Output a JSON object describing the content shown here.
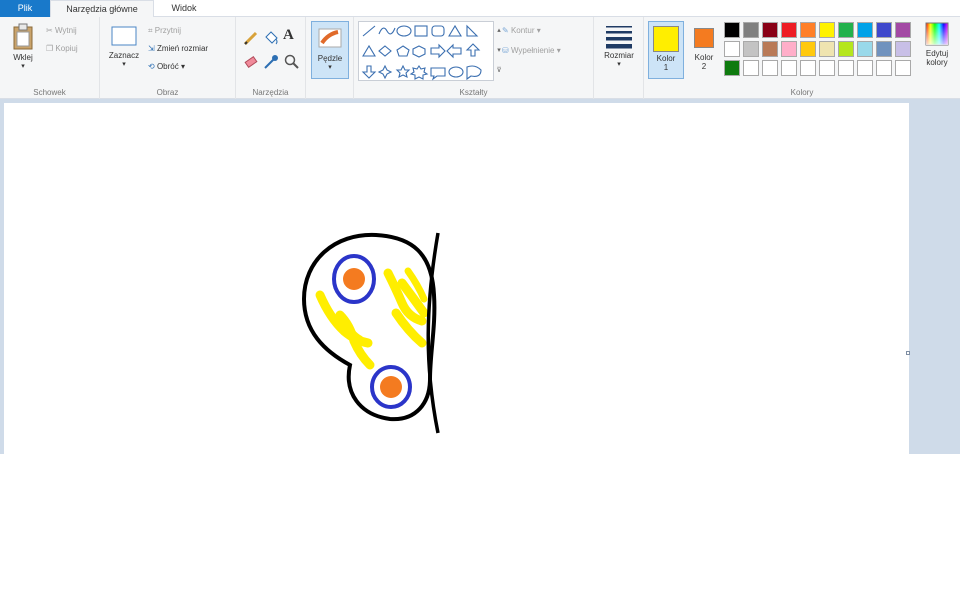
{
  "tabs": {
    "file": "Plik",
    "home": "Narzędzia główne",
    "view": "Widok"
  },
  "clipboard": {
    "paste": "Wklej",
    "cut": "Wytnij",
    "copy": "Kopiuj",
    "label": "Schowek"
  },
  "image": {
    "select": "Zaznacz",
    "crop": "Przytnij",
    "resize": "Zmień rozmiar",
    "rotate": "Obróć",
    "label": "Obraz"
  },
  "tools": {
    "label": "Narzędzia"
  },
  "brushes": {
    "label": "Pędzle"
  },
  "shapes": {
    "outline": "Kontur",
    "fill": "Wypełnienie",
    "label": "Kształty"
  },
  "size": {
    "label": "Rozmiar"
  },
  "colors": {
    "color1_label": "Kolor",
    "color1_num": "1",
    "color2_label": "Kolor",
    "color2_num": "2",
    "edit_label_1": "Edytuj",
    "edit_label_2": "kolory",
    "label": "Kolory",
    "color1": "#ffee00",
    "color2": "#f47b20",
    "palette": [
      "#000000",
      "#7f7f7f",
      "#880015",
      "#ed1c24",
      "#ff7f27",
      "#fff200",
      "#22b14c",
      "#00a2e8",
      "#3f48cc",
      "#a349a4",
      "#ffffff",
      "#c3c3c3",
      "#b97a57",
      "#ffaec9",
      "#ffc90e",
      "#efe4b0",
      "#b5e61d",
      "#99d9ea",
      "#7092be",
      "#c8bfe7",
      "#0e7a0e",
      "#ffffff",
      "#ffffff",
      "#ffffff",
      "#ffffff",
      "#ffffff",
      "#ffffff",
      "#ffffff",
      "#ffffff",
      "#ffffff"
    ]
  },
  "drawing": {
    "outline_color": "#000000",
    "stroke_color": "#ffee00",
    "ring_color": "#2b35c9",
    "spot_color": "#f47b20"
  }
}
